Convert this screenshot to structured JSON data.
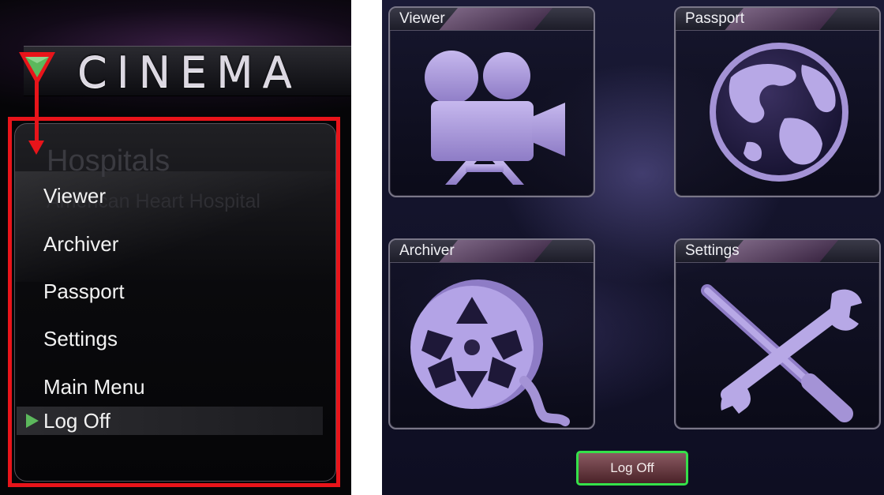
{
  "left": {
    "logo_text": "CINEMA",
    "ghost_title": "Hospitals",
    "ghost_subtitle": "American Heart Hospital",
    "menu_items": [
      {
        "label": "Viewer"
      },
      {
        "label": "Archiver"
      },
      {
        "label": "Passport"
      },
      {
        "label": "Settings"
      },
      {
        "label": "Main Menu"
      },
      {
        "label": "Log Off",
        "selected": true
      }
    ]
  },
  "right": {
    "tiles": [
      {
        "label": "Viewer",
        "icon": "movie-camera-icon"
      },
      {
        "label": "Passport",
        "icon": "globe-icon"
      },
      {
        "label": "Archiver",
        "icon": "film-reel-icon"
      },
      {
        "label": "Settings",
        "icon": "wrench-screwdriver-icon"
      }
    ],
    "logoff_label": "Log Off"
  },
  "colors": {
    "highlight_red": "#e8141a",
    "accent_green": "#35e04a",
    "icon_lavender": "#a493d6",
    "triangle_green": "#5cb85c"
  }
}
